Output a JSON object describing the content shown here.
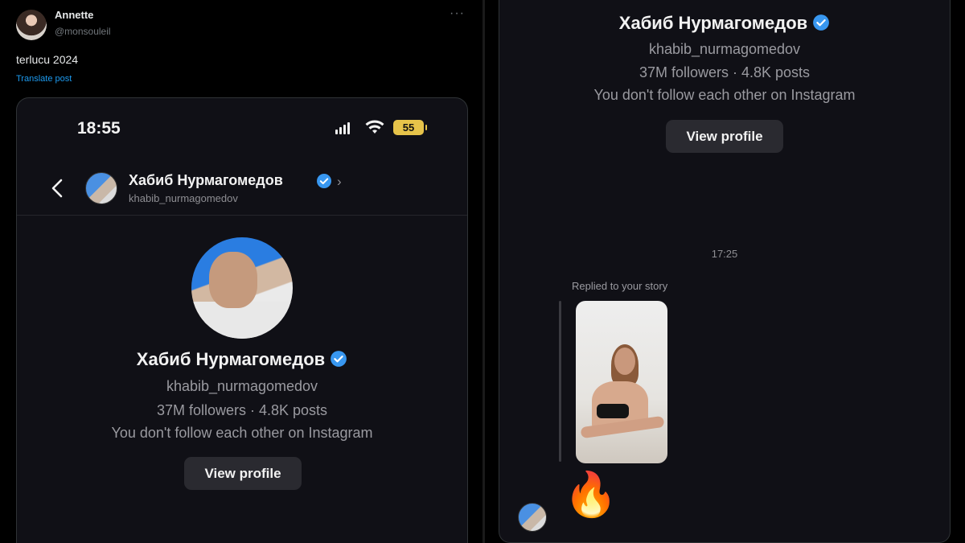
{
  "tweet": {
    "author_name": "Annette",
    "author_handle": "@monsouleil",
    "more_label": "···",
    "text": "terlucu 2024",
    "translate_label": "Translate post"
  },
  "phone": {
    "status_time": "18:55",
    "battery": "55"
  },
  "chat_header": {
    "name": "Хабиб Нурмагомедов",
    "handle": "khabib_nurmagomedov",
    "chevron": "›"
  },
  "profile": {
    "name": "Хабиб Нурмагомедов",
    "handle": "khabib_nurmagomedov",
    "stats": "37M followers · 4.8K posts",
    "relation": "You don't follow each other on Instagram",
    "view_profile_label": "View profile"
  },
  "continuation": {
    "name": "Хабиб Нурмагомедов",
    "handle": "khabib_nurmagomedov",
    "stats": "37M followers · 4.8K posts",
    "relation": "You don't follow each other on Instagram",
    "view_profile_label": "View profile",
    "timestamp": "17:25",
    "replied_label": "Replied to your story",
    "reaction": "🔥"
  },
  "colors": {
    "verified": "#3897f0",
    "battery": "#e6c34a",
    "link": "#1d9bf0"
  },
  "icons": [
    "back-arrow-icon",
    "verified-icon",
    "chevron-right-icon",
    "signal-icon",
    "wifi-icon",
    "battery-icon",
    "more-icon",
    "fire-emoji"
  ]
}
